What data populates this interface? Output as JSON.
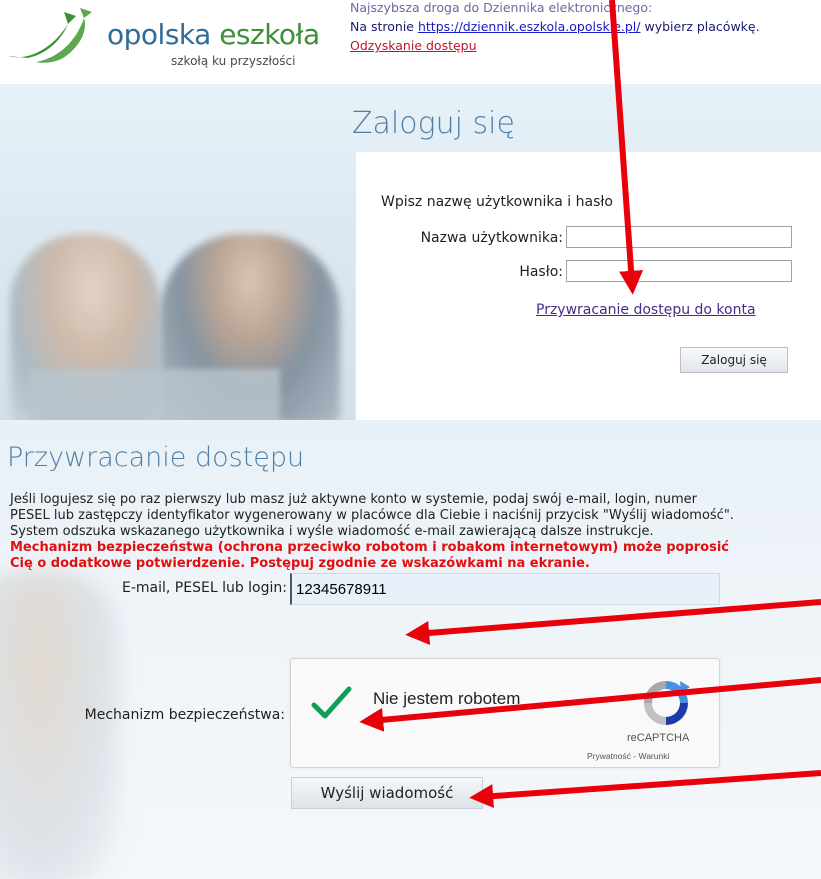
{
  "header": {
    "logo_name_part1": "opolska ",
    "logo_name_part2": "eszkoła",
    "logo_tagline": "szkołą ku przyszłości",
    "line1": "Najszybsza droga do Dziennika elektronicznego:",
    "line2_prefix": "Na stronie ",
    "line2_link": "https://dziennik.eszkola.opolskie.pl/",
    "line2_suffix": " wybierz placówkę.",
    "line3_link": "Odzyskanie dostępu"
  },
  "login": {
    "title": "Zaloguj się",
    "prompt": "Wpisz nazwę użytkownika i hasło",
    "username_label": "Nazwa użytkownika:",
    "password_label": "Hasło:",
    "username_value": "",
    "password_value": "",
    "recover_link": "Przywracanie dostępu do konta",
    "submit_label": "Zaloguj się"
  },
  "reset": {
    "title": "Przywracanie dostępu",
    "description_lines": [
      "Jeśli logujesz się po raz pierwszy lub masz już aktywne konto w systemie, podaj swój e-mail, login, numer",
      "PESEL lub zastępczy identyfikator wygenerowany w placówce dla Ciebie i naciśnij przycisk \"Wyślij wiadomość\".",
      "System odszuka wskazanego użytkownika i wyśle wiadomość e-mail zawierającą dalsze instrukcje."
    ],
    "warning_lines": [
      "Mechanizm bezpieczeństwa (ochrona przeciwko robotom i robakom internetowym) może poprosić",
      "Cię o dodatkowe potwierdzenie. Postępuj zgodnie ze wskazówkami na ekranie."
    ],
    "email_label": "E-mail, PESEL lub login:",
    "email_value": "12345678911",
    "security_label": "Mechanizm bezpieczeństwa:",
    "captcha_text": "Nie jestem robotem",
    "captcha_brand": "reCAPTCHA",
    "captcha_links": "Prywatność - Warunki",
    "submit_label": "Wyślij wiadomość"
  },
  "colors": {
    "title_blue": "#4f7fa7",
    "warning_red": "#e20f0f",
    "arrow_red": "#e8000b",
    "check_green": "#0f9d58"
  },
  "icons": [
    "logo-swoosh-icon",
    "checkmark-icon",
    "recaptcha-icon",
    "annotation-arrow-icon"
  ]
}
